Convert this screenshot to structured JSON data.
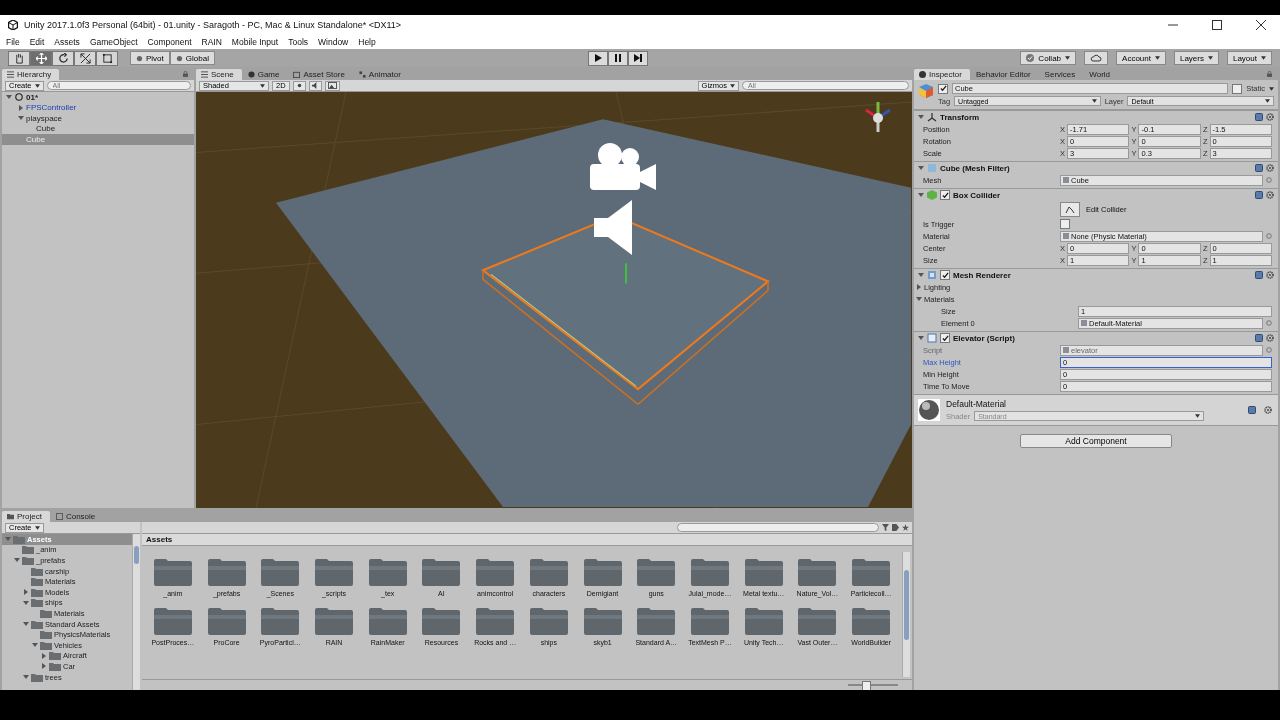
{
  "window": {
    "title": "Unity 2017.1.0f3 Personal (64bit) - 01.unity - Saragoth - PC, Mac & Linux Standalone* <DX11>"
  },
  "menu": [
    "File",
    "Edit",
    "Assets",
    "GameObject",
    "Component",
    "RAIN",
    "Mobile Input",
    "Tools",
    "Window",
    "Help"
  ],
  "toolbar": {
    "tools": [
      {
        "kind": "hand",
        "selected": false
      },
      {
        "kind": "move",
        "selected": true
      },
      {
        "kind": "rotate",
        "selected": false
      },
      {
        "kind": "scale",
        "selected": false
      },
      {
        "kind": "rect",
        "selected": false
      }
    ],
    "pivot": "Pivot",
    "global": "Global",
    "right": [
      {
        "kind": "collab",
        "label": "Collab"
      },
      {
        "kind": "cloud"
      },
      {
        "kind": "menu",
        "label": "Account"
      },
      {
        "kind": "menu",
        "label": "Layers"
      },
      {
        "kind": "menu",
        "label": "Layout"
      }
    ]
  },
  "hierarchy": {
    "tab": "Hierarchy",
    "create": "Create",
    "search": {
      "placeholder": "All"
    },
    "scene": {
      "label": "01*",
      "expanded": true
    },
    "items": [
      {
        "label": "FPSController",
        "prefab": true,
        "expanded": false,
        "selected": false
      },
      {
        "label": "playspace",
        "prefab": false,
        "expanded": true,
        "selected": false,
        "children": [
          {
            "label": "Cube",
            "prefab": false,
            "selected": false
          }
        ]
      },
      {
        "label": "Cube",
        "prefab": false,
        "selected": true
      }
    ]
  },
  "scene_view": {
    "tabs": [
      {
        "kind": "scene",
        "label": "Scene",
        "selected": true
      },
      {
        "kind": "game",
        "label": "Game",
        "selected": false
      },
      {
        "kind": "store",
        "label": "Asset Store",
        "selected": false
      },
      {
        "kind": "animator",
        "label": "Animator",
        "selected": false
      }
    ],
    "shading": "Shaded",
    "mode_2d": "2D",
    "gizmos": "Gizmos",
    "search": {
      "placeholder": "All"
    }
  },
  "inspector": {
    "tabs": [
      {
        "label": "Inspector",
        "selected": true
      },
      {
        "label": "Behavior Editor",
        "selected": false
      },
      {
        "label": "Services",
        "selected": false
      },
      {
        "label": "World",
        "selected": false
      }
    ],
    "object": {
      "active": true,
      "name": "Cube",
      "static": false,
      "static_label": "Static",
      "tag_label": "Tag",
      "tag": "Untagged",
      "layer_label": "Layer",
      "layer": "Default"
    },
    "components": [
      {
        "kind": "transform",
        "title": "Transform",
        "expanded": true,
        "rows": [
          {
            "kind": "vector",
            "label": "Position",
            "axes": [
              {
                "axis": "X",
                "value": "-1.71"
              },
              {
                "axis": "Y",
                "value": "-0.1"
              },
              {
                "axis": "Z",
                "value": "-1.5"
              }
            ]
          },
          {
            "kind": "vector",
            "label": "Rotation",
            "axes": [
              {
                "axis": "X",
                "value": "0"
              },
              {
                "axis": "Y",
                "value": "0"
              },
              {
                "axis": "Z",
                "value": "0"
              }
            ]
          },
          {
            "kind": "vector",
            "label": "Scale",
            "axes": [
              {
                "axis": "X",
                "value": "3"
              },
              {
                "axis": "Y",
                "value": "0.3"
              },
              {
                "axis": "Z",
                "value": "3"
              }
            ]
          }
        ]
      },
      {
        "kind": "mesh",
        "title": "Cube (Mesh Filter)",
        "expanded": true,
        "rows": [
          {
            "kind": "object",
            "label": "Mesh",
            "value": "Cube",
            "disabled": false
          }
        ]
      },
      {
        "kind": "collider",
        "title": "Box Collider",
        "enabled": true,
        "expanded": true,
        "rows": [
          {
            "kind": "button",
            "value": "Edit Collider"
          },
          {
            "kind": "checkbox",
            "label": "Is Trigger",
            "checked": false
          },
          {
            "kind": "object",
            "label": "Material",
            "value": "None (Physic Material)",
            "disabled": false
          },
          {
            "kind": "vector",
            "label": "Center",
            "axes": [
              {
                "axis": "X",
                "value": "0"
              },
              {
                "axis": "Y",
                "value": "0"
              },
              {
                "axis": "Z",
                "value": "0"
              }
            ]
          },
          {
            "kind": "vector",
            "label": "Size",
            "axes": [
              {
                "axis": "X",
                "value": "1"
              },
              {
                "axis": "Y",
                "value": "1"
              },
              {
                "axis": "Z",
                "value": "1"
              }
            ]
          }
        ]
      },
      {
        "kind": "renderer",
        "title": "Mesh Renderer",
        "enabled": true,
        "expanded": true,
        "rows": [
          {
            "kind": "foldout",
            "label": "Lighting",
            "expanded": false
          },
          {
            "kind": "foldout",
            "label": "Materials",
            "expanded": true,
            "children": [
              {
                "kind": "text",
                "label": "Size",
                "value": "1",
                "focused": false
              },
              {
                "kind": "object",
                "label": "Element 0",
                "value": "Default-Material",
                "disabled": false
              }
            ]
          }
        ]
      },
      {
        "kind": "script",
        "title": "Elevator (Script)",
        "enabled": true,
        "expanded": true,
        "rows": [
          {
            "kind": "object",
            "label": "Script",
            "value": "elevator",
            "disabled": true
          },
          {
            "kind": "text",
            "label": "Max Height",
            "value": "0",
            "focused": true
          },
          {
            "kind": "text",
            "label": "Min Height",
            "value": "0",
            "focused": false
          },
          {
            "kind": "text",
            "label": "Time To Move",
            "value": "0",
            "focused": false
          }
        ]
      }
    ],
    "material": {
      "name": "Default-Material",
      "shader_label": "Shader",
      "shader": "Standard"
    },
    "add_component": "Add Component"
  },
  "project": {
    "tabs": [
      {
        "label": "Project",
        "selected": true
      },
      {
        "label": "Console",
        "selected": false
      }
    ],
    "create": "Create",
    "tree": [
      {
        "label": "Assets",
        "expanded": true,
        "selected": true,
        "children": [
          {
            "label": "_anim",
            "selected": false
          },
          {
            "label": "_prefabs",
            "expanded": true,
            "selected": false,
            "children": [
              {
                "label": "carship",
                "selected": false
              },
              {
                "label": "Materials",
                "selected": false
              },
              {
                "label": "Models",
                "expanded": false,
                "selected": false
              },
              {
                "label": "ships",
                "expanded": true,
                "selected": false,
                "children": [
                  {
                    "label": "Materials",
                    "selected": false
                  }
                ]
              },
              {
                "label": "Standard Assets",
                "expanded": true,
                "selected": false,
                "children": [
                  {
                    "label": "PhysicsMaterials",
                    "selected": false
                  },
                  {
                    "label": "Vehicles",
                    "expanded": true,
                    "selected": false,
                    "children": [
                      {
                        "label": "Aircraft",
                        "expanded": false,
                        "selected": false
                      },
                      {
                        "label": "Car",
                        "expanded": false,
                        "selected": false
                      }
                    ]
                  }
                ]
              },
              {
                "label": "trees",
                "expanded": true,
                "selected": false
              }
            ]
          }
        ]
      }
    ],
    "breadcrumb": "Assets",
    "icon_size": {
      "level": 0.35
    },
    "folders": [
      "_anim",
      "_prefabs",
      "_Scenes",
      "_scripts",
      "_tex",
      "AI",
      "animcontrol",
      "characters",
      "Demigiant",
      "guns",
      "Julai_mode…",
      "Metal textu…",
      "Nature_Vol…",
      "Particlecoll…",
      "PostProces…",
      "ProCore",
      "PyroParticl…",
      "RAIN",
      "RainMaker",
      "Resources",
      "Rocks and …",
      "ships",
      "skyb1",
      "Standard A…",
      "TextMesh P…",
      "Unity Tech…",
      "Vast Outer…",
      "WorldBuilder"
    ]
  }
}
